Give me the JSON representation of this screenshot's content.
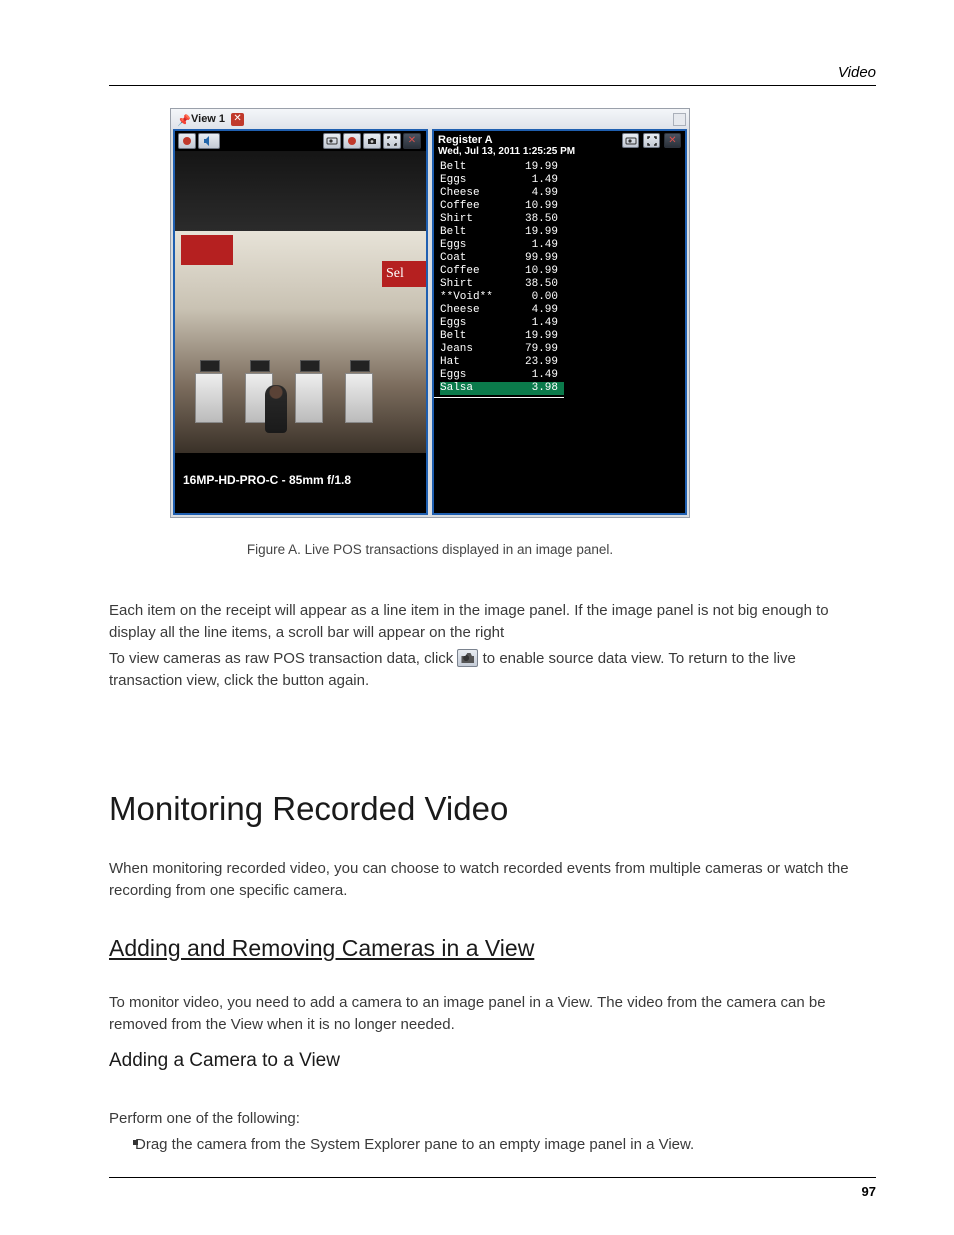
{
  "page": {
    "header_section": "Video",
    "page_number": "97"
  },
  "figure": {
    "tab_label": "View 1",
    "camera_caption": "16MP-HD-PRO-C - 85mm f/1.8",
    "sel_sign": "Sel",
    "caption_text": "Figure A.     Live POS transactions displayed in an image panel.",
    "pos": {
      "register": "Register A",
      "timestamp": "Wed, Jul 13, 2011 1:25:25 PM",
      "items": [
        {
          "name": "Belt",
          "price": "19.99",
          "hl": false
        },
        {
          "name": "Eggs",
          "price": "1.49",
          "hl": false
        },
        {
          "name": "Cheese",
          "price": "4.99",
          "hl": false
        },
        {
          "name": "Coffee",
          "price": "10.99",
          "hl": false
        },
        {
          "name": "Shirt",
          "price": "38.50",
          "hl": false
        },
        {
          "name": "Belt",
          "price": "19.99",
          "hl": false
        },
        {
          "name": "Eggs",
          "price": "1.49",
          "hl": false
        },
        {
          "name": "Coat",
          "price": "99.99",
          "hl": false
        },
        {
          "name": "Coffee",
          "price": "10.99",
          "hl": false
        },
        {
          "name": "Shirt",
          "price": "38.50",
          "hl": false
        },
        {
          "name": "**Void**",
          "price": "0.00",
          "hl": false
        },
        {
          "name": "Cheese",
          "price": "4.99",
          "hl": false
        },
        {
          "name": "Eggs",
          "price": "1.49",
          "hl": false
        },
        {
          "name": "Belt",
          "price": "19.99",
          "hl": false
        },
        {
          "name": "Jeans",
          "price": "79.99",
          "hl": false
        },
        {
          "name": "Hat",
          "price": "23.99",
          "hl": false
        },
        {
          "name": "Eggs",
          "price": "1.49",
          "hl": false
        },
        {
          "name": "Salsa",
          "price": "3.98",
          "hl": true
        }
      ]
    }
  },
  "text": {
    "para1": "Each item on the receipt will appear as a line item in the image panel. If the image panel is not big enough to display all the line items, a scroll bar will appear on the right",
    "para2_a": "To view cameras as raw POS transaction data, click ",
    "para2_b": " to enable source data view. To return to the live transaction view, click the button again.",
    "h1": "Monitoring Recorded Video",
    "sec_desc": "When monitoring recorded video, you can choose to watch recorded events from multiple cameras or watch the recording from one specific camera.",
    "h2": "Adding and Removing Cameras in a View",
    "sub_desc": "To monitor video, you need to add a camera to an image panel in a View. The video from the camera can be removed from the View when it is no longer needed.",
    "h3": "Adding a Camera to a View",
    "steps_intro": "Perform one of the following:",
    "bullet1": "Drag the camera from the System Explorer pane to an empty image panel in a View."
  }
}
